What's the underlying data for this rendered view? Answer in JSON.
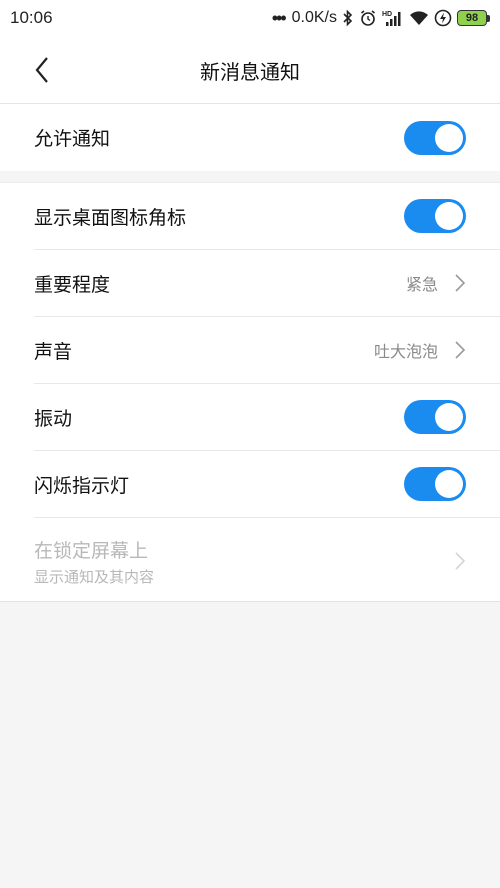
{
  "status_bar": {
    "time": "10:06",
    "network_speed": "0.0K/s",
    "battery": "98",
    "icons": [
      "bluetooth-icon",
      "alarm-icon",
      "hd-signal-icon",
      "wifi-icon",
      "charging-icon"
    ]
  },
  "header": {
    "title": "新消息通知",
    "back_icon": "chevron-left-icon"
  },
  "settings": {
    "allow_notifications": {
      "label": "允许通知",
      "enabled": true
    },
    "badge": {
      "label": "显示桌面图标角标",
      "enabled": true
    },
    "importance": {
      "label": "重要程度",
      "value": "紧急"
    },
    "sound": {
      "label": "声音",
      "value": "吐大泡泡"
    },
    "vibration": {
      "label": "振动",
      "enabled": true
    },
    "led": {
      "label": "闪烁指示灯",
      "enabled": true
    },
    "lock_screen": {
      "label": "在锁定屏幕上",
      "value": "显示通知及其内容"
    }
  },
  "colors": {
    "toggle_on": "#1a8cf0",
    "background": "#f5f5f5",
    "secondary_text": "#8a8a8a",
    "disabled_text": "#b8b8b8"
  }
}
